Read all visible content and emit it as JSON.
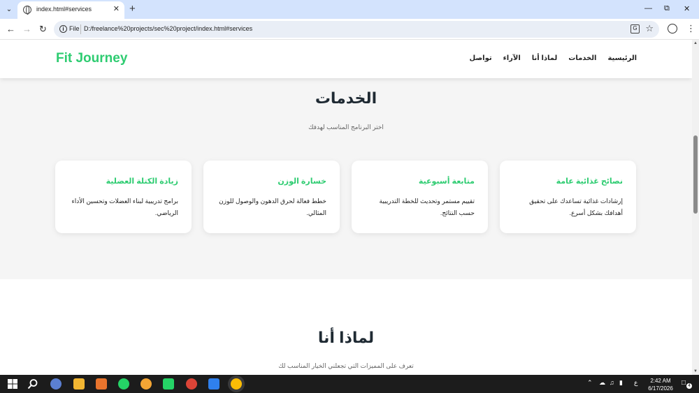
{
  "browser": {
    "tab_title": "index.html#services",
    "address_scheme": "File",
    "address_url": "D:/freelance%20projects/sec%20project/index.html#services"
  },
  "site": {
    "logo": "Fit Journey",
    "nav": [
      "الرئيسية",
      "الخدمات",
      "لماذا أنا",
      "الآراء",
      "تواصل"
    ]
  },
  "services": {
    "title": "الخدمات",
    "subtitle": "اختر البرنامج المناسب لهدفك",
    "cards": [
      {
        "title": "نصائح غذائية عامة",
        "text": "إرشادات غذائية تساعدك على تحقيق أهدافك بشكل أسرع."
      },
      {
        "title": "متابعة أسبوعية",
        "text": "تقييم مستمر وتحديث للخطة التدريبية حسب النتائج."
      },
      {
        "title": "خسارة الوزن",
        "text": "خطط فعالة لحرق الدهون والوصول للوزن المثالي."
      },
      {
        "title": "زيادة الكتلة العضلية",
        "text": "برامج تدريبية لبناء العضلات وتحسين الأداء الرياضي."
      }
    ]
  },
  "why": {
    "title": "لماذا أنا",
    "subtitle": "تعرف على المميزات التي تجعلني الخيار المناسب لك"
  },
  "taskbar": {
    "time": "2:42 AM",
    "date": "6/17/2026",
    "lang": "ع",
    "notifications": "4"
  },
  "colors": {
    "accent": "#2ecc71",
    "tab_strip": "#d3e3fd",
    "taskbar": "#1c1c1c"
  }
}
